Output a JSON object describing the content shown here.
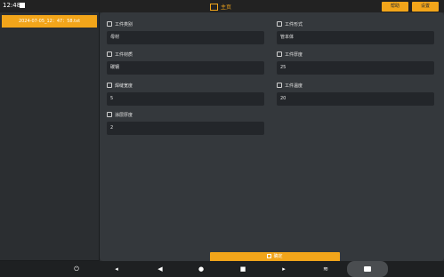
{
  "status": {
    "time": "12:48"
  },
  "header": {
    "title": "主页",
    "btn1": "帮助",
    "btn2": "设置"
  },
  "sidebar": {
    "items": [
      {
        "label": "2024-07-05_12：47：58.txt"
      }
    ]
  },
  "fields": [
    {
      "label": "工件类别",
      "value": "母材",
      "icon": "grid-icon"
    },
    {
      "label": "工件形式",
      "value": "管本体",
      "icon": "grid-icon"
    },
    {
      "label": "工件材质",
      "value": "碳钢",
      "icon": "wifi-icon"
    },
    {
      "label": "工件厚度",
      "value": "25",
      "icon": "ruler-icon"
    },
    {
      "label": "焊缝宽度",
      "value": "5",
      "icon": "box-icon"
    },
    {
      "label": "工件温度",
      "value": "20",
      "icon": "thermometer-icon"
    },
    {
      "label": "涂层厚度",
      "value": "2",
      "icon": "layers-icon"
    }
  ],
  "confirm": {
    "label": "确定"
  },
  "nav": [
    "power",
    "volume-down",
    "back",
    "home",
    "recent",
    "volume-up",
    "expand",
    "camera"
  ]
}
